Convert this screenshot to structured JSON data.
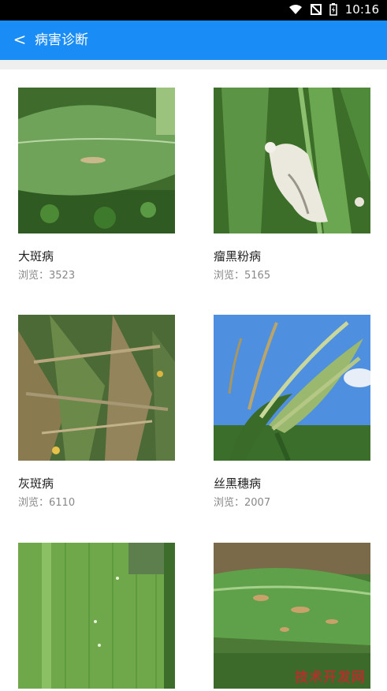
{
  "status_bar": {
    "time": "10:16"
  },
  "header": {
    "back_label": "<",
    "title": "病害诊断"
  },
  "cards": [
    {
      "name": "大斑病",
      "views": "浏览：3523"
    },
    {
      "name": "瘤黑粉病",
      "views": "浏览：5165"
    },
    {
      "name": "灰斑病",
      "views": "浏览：6110"
    },
    {
      "name": "丝黑穗病",
      "views": "浏览：2007"
    },
    {
      "name": "",
      "views": ""
    },
    {
      "name": "",
      "views": ""
    }
  ],
  "footer_watermark": "技术开发网"
}
